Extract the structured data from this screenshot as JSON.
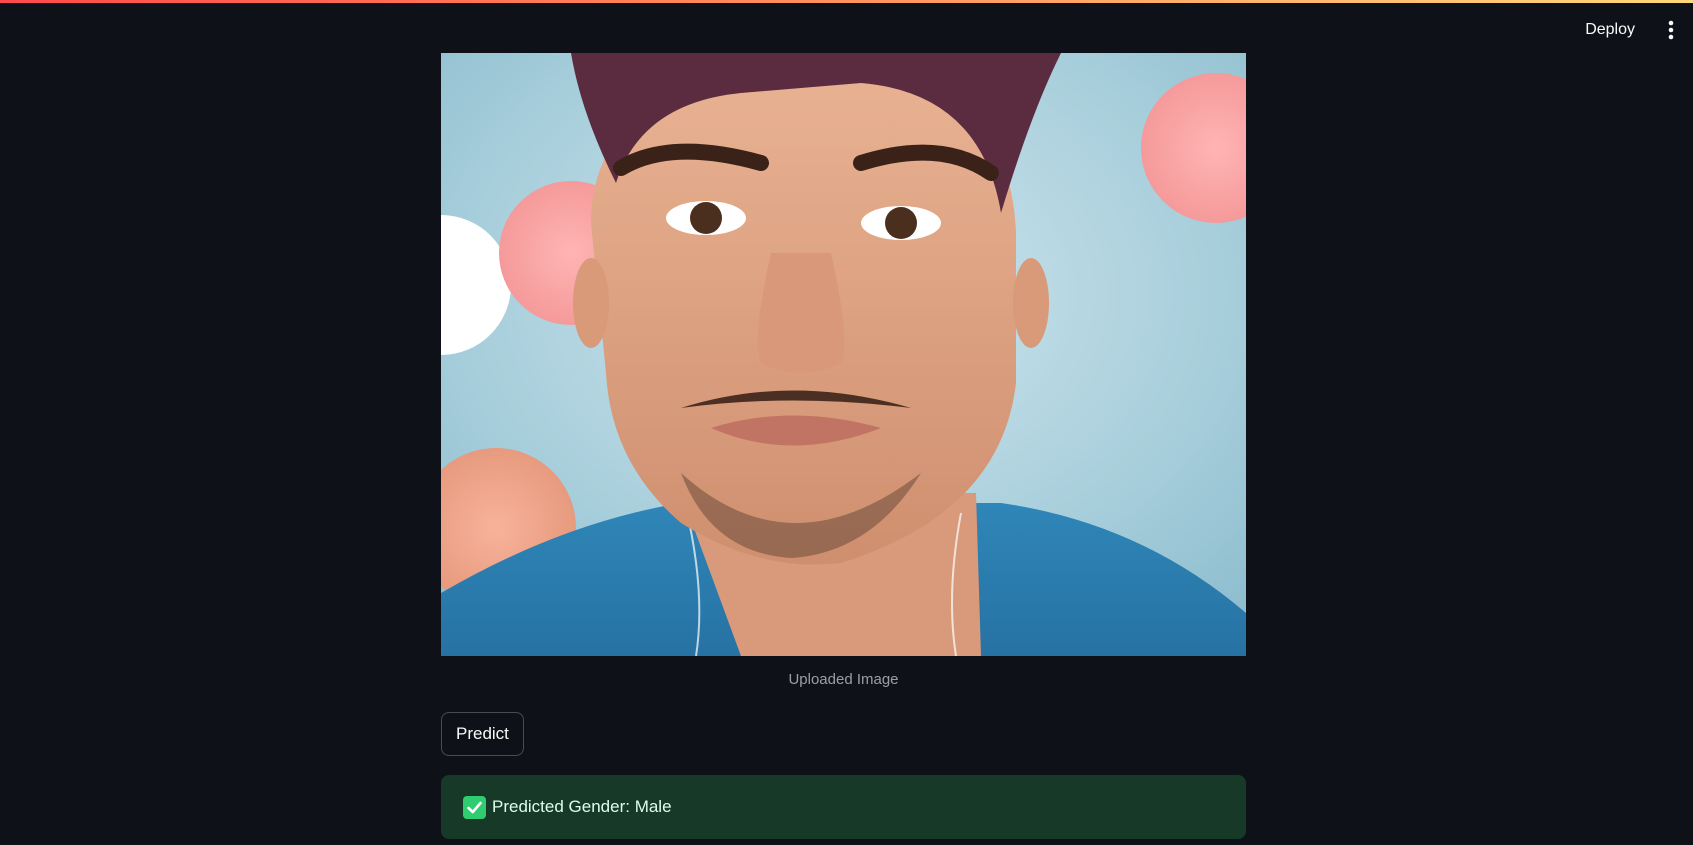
{
  "header": {
    "deploy_label": "Deploy",
    "menu_icon": "vertical-ellipsis-icon",
    "accent_gradient": [
      "#ff4b4b",
      "#ffd87a"
    ]
  },
  "main": {
    "image_caption": "Uploaded Image",
    "predict_label": "Predict",
    "result": {
      "icon": "check-mark-icon",
      "text": "Predicted Gender: Male",
      "status_color": "#173928"
    }
  }
}
